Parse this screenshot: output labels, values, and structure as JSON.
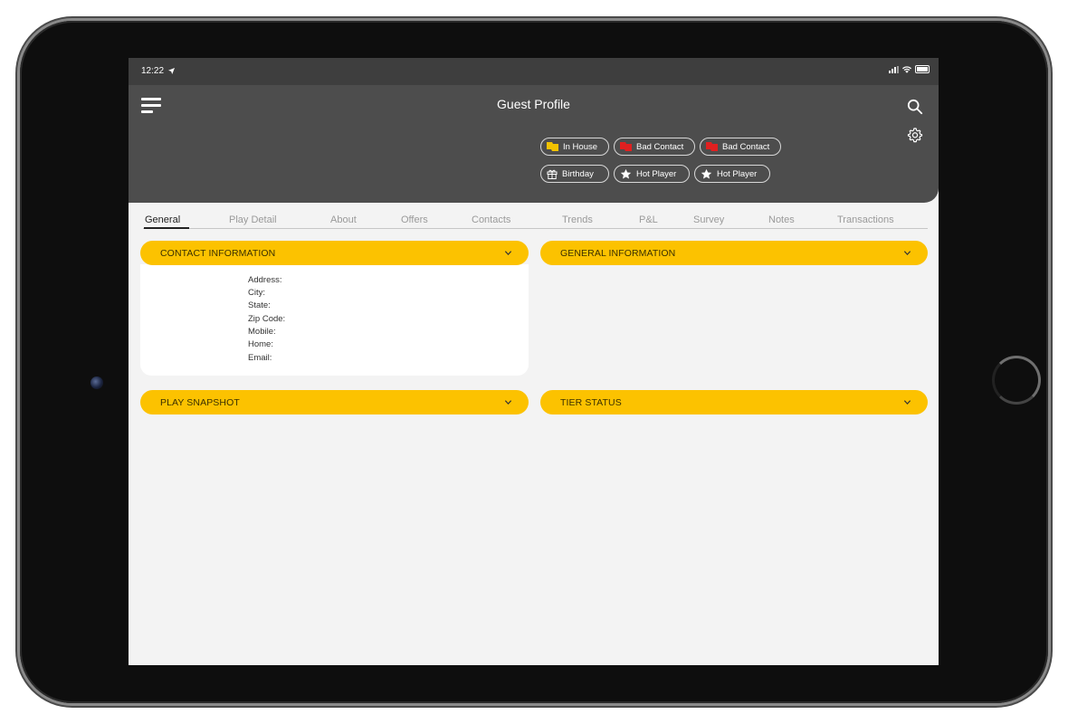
{
  "status_bar": {
    "time": "12:22"
  },
  "header": {
    "title": "Guest Profile"
  },
  "flags": [
    {
      "label": "In House",
      "icon": "flag-icon",
      "color": "#f2c200"
    },
    {
      "label": "Bad Contact",
      "icon": "flag-icon",
      "color": "#e02020"
    },
    {
      "label": "Bad Contact",
      "icon": "flag-icon",
      "color": "#e02020"
    },
    {
      "label": "Birthday",
      "icon": "gift-icon",
      "color": "#ffffff"
    },
    {
      "label": "Hot Player",
      "icon": "star-icon",
      "color": "#ffffff"
    },
    {
      "label": "Hot Player",
      "icon": "star-icon",
      "color": "#ffffff"
    }
  ],
  "tabs": [
    {
      "label": "General",
      "active": true
    },
    {
      "label": "Play Detail"
    },
    {
      "label": "About"
    },
    {
      "label": "Offers"
    },
    {
      "label": "Contacts"
    },
    {
      "label": "Trends"
    },
    {
      "label": "P&L"
    },
    {
      "label": "Survey"
    },
    {
      "label": "Notes"
    },
    {
      "label": "Transactions"
    }
  ],
  "sections": {
    "contact_information": {
      "title": "CONTACT INFORMATION",
      "fields": [
        "Address:",
        "City:",
        "State:",
        "Zip Code:",
        "Mobile:",
        "Home:",
        "Email:"
      ]
    },
    "general_information": {
      "title": "GENERAL INFORMATION"
    },
    "play_snapshot": {
      "title": "PLAY SNAPSHOT"
    },
    "tier_status": {
      "title": "TIER STATUS"
    }
  },
  "colors": {
    "accent": "#fcc200",
    "header_bg": "#4d4d4d",
    "screen_bg": "#f3f3f3"
  }
}
